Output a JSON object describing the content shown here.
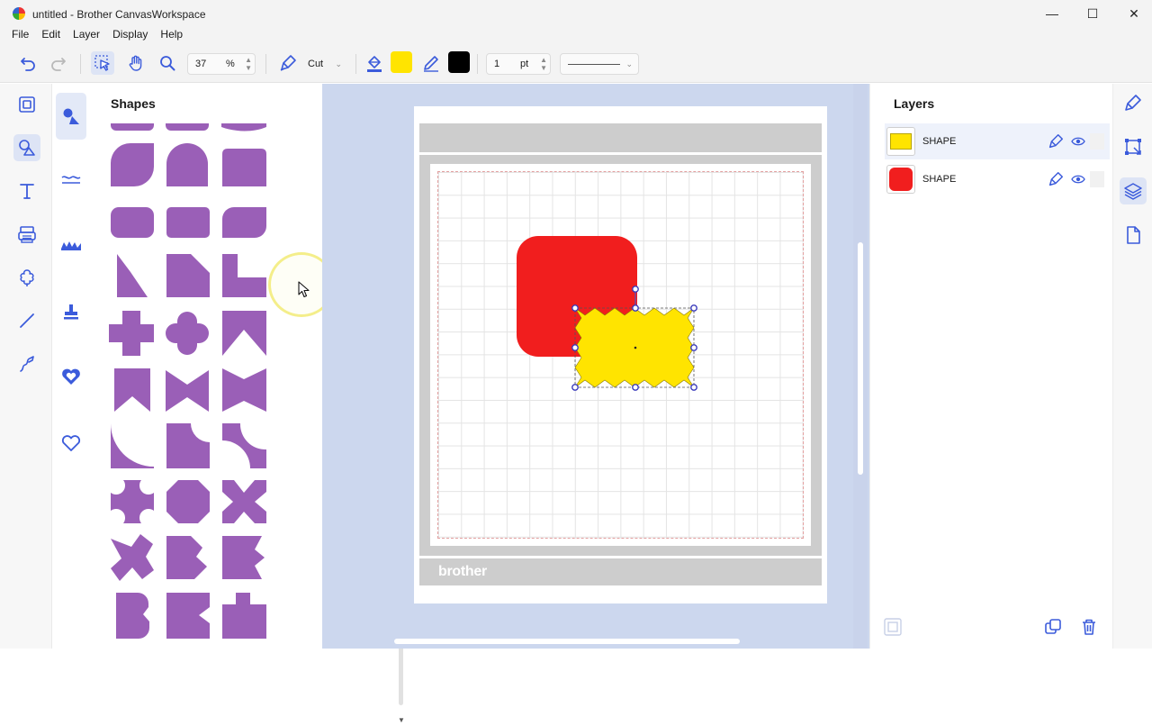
{
  "window": {
    "title": "untitled - Brother CanvasWorkspace",
    "minimize_glyph": "—",
    "maximize_glyph": "☐",
    "close_glyph": "✕"
  },
  "menu": [
    "File",
    "Edit",
    "Layer",
    "Display",
    "Help"
  ],
  "toolbar": {
    "zoom_value": "37",
    "zoom_unit": "%",
    "mode_label": "Cut",
    "fill_color": "#FFE400",
    "line_color": "#000000",
    "line_width_value": "1",
    "line_width_unit": "pt"
  },
  "icons": {
    "left_rail": [
      "template-icon",
      "shapes-icon",
      "text-icon",
      "scan-icon",
      "cloud-shape-icon",
      "line-icon",
      "freehand-icon"
    ],
    "category_column": [
      "basic-shapes-icon",
      "wave-lines-icon",
      "decorative-icon",
      "stamp-icon",
      "heart-badge-icon",
      "heart-icon"
    ],
    "right_rail": [
      "edit-brush-icon",
      "transform-icon",
      "layers-icon",
      "page-icon"
    ]
  },
  "shapes_panel": {
    "title": "Shapes",
    "shape_color": "#9A5FB7"
  },
  "canvas": {
    "mat_label": "brother",
    "red_shape_color": "#F11E1E",
    "yellow_shape_color": "#FFE400"
  },
  "layers_panel": {
    "title": "Layers",
    "items": [
      {
        "label": "SHAPE",
        "color": "#FFE400",
        "selected": true
      },
      {
        "label": "SHAPE",
        "color": "#F11E1E",
        "selected": false
      }
    ]
  },
  "colors": {
    "accent": "#3B5BDB",
    "canvas_bg": "#CCD7EE"
  }
}
